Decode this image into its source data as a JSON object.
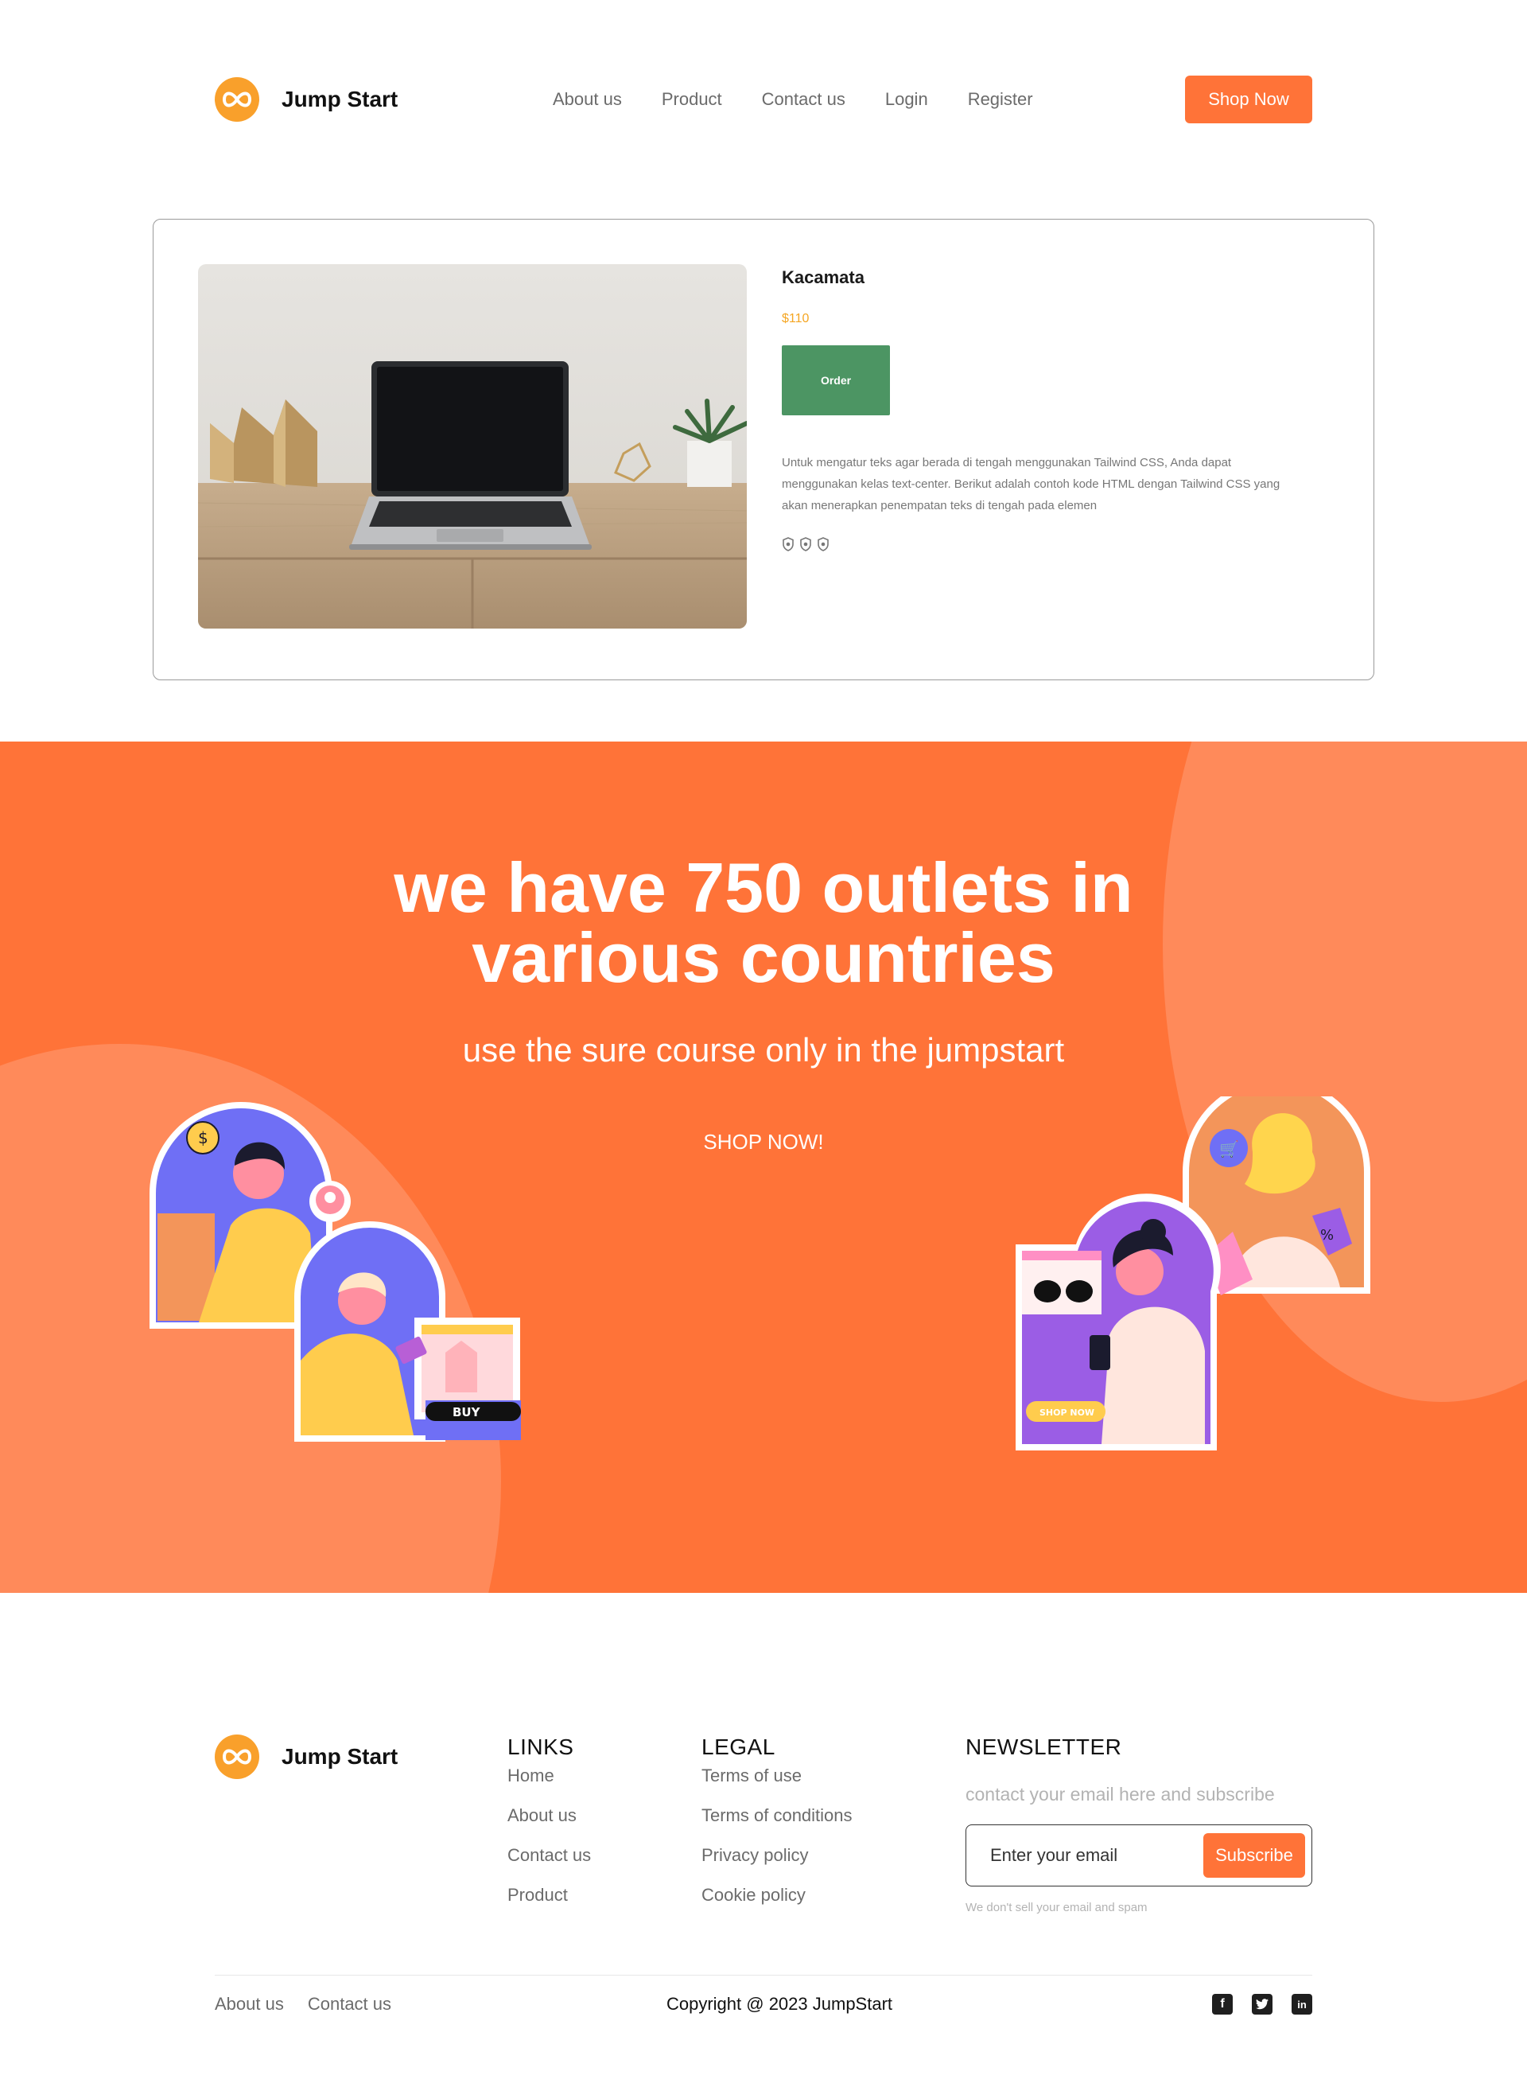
{
  "brand": {
    "name": "Jump Start"
  },
  "nav": {
    "links": [
      "About us",
      "Product",
      "Contact us",
      "Login",
      "Register"
    ],
    "cta": "Shop Now"
  },
  "product": {
    "name": "Kacamata",
    "price": "$110",
    "order_label": "Order",
    "description": "Untuk mengatur teks agar berada di tengah menggunakan Tailwind CSS, Anda dapat menggunakan kelas text-center. Berikut adalah contoh kode HTML dengan Tailwind CSS yang akan menerapkan penempatan teks di tengah pada elemen",
    "rating_icons": 3
  },
  "promo": {
    "title_line1": "we have 750 outlets in",
    "title_line2": "various countries",
    "subtitle": "use the sure course only in the jumpstart",
    "cta": "SHOP NOW!",
    "sticker_buy": "BUY",
    "sticker_shop_now": "SHOP NOW"
  },
  "footer": {
    "brand": "Jump Start",
    "links": {
      "title": "LINKS",
      "items": [
        "Home",
        "About us",
        "Contact us",
        "Product"
      ]
    },
    "legal": {
      "title": "LEGAL",
      "items": [
        "Terms of use",
        "Terms of conditions",
        "Privacy policy",
        "Cookie policy"
      ]
    },
    "newsletter": {
      "title": "NEWSLETTER",
      "description": "contact your email here and subscribe",
      "placeholder": "Enter your email",
      "button": "Subscribe",
      "note": "We don't sell your email and spam"
    },
    "bottom_links": [
      "About us",
      "Contact us"
    ],
    "copyright": "Copyright @ 2023 JumpStart",
    "socials": [
      "facebook-icon",
      "twitter-icon",
      "linkedin-icon"
    ]
  },
  "colors": {
    "accent": "#ff7338",
    "logo": "#f9a02b",
    "order": "#4c9563",
    "price": "#f5a623"
  }
}
